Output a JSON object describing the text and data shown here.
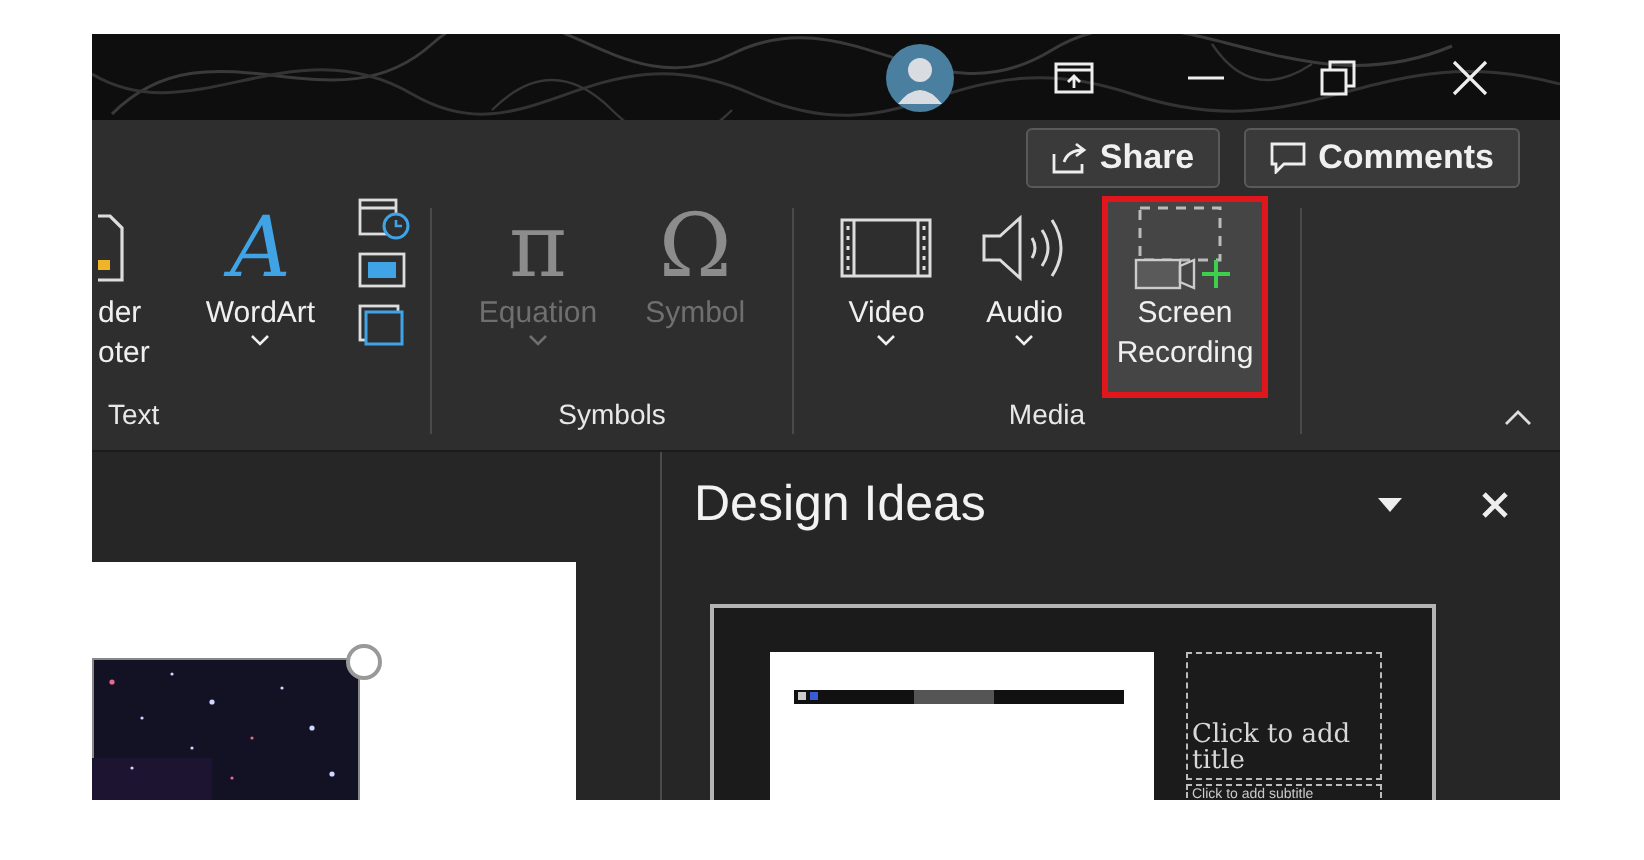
{
  "ribbon": {
    "actions": [
      {
        "kind": "share",
        "label": "Share"
      },
      {
        "kind": "comments",
        "label": "Comments"
      }
    ],
    "groups": [
      {
        "label": "Text",
        "items": [
          {
            "kind": "header-footer",
            "lines": [
              "der",
              "oter"
            ]
          },
          {
            "kind": "wordart",
            "glyph": "A",
            "lines": [
              "WordArt"
            ],
            "dropdown": true
          },
          {
            "kind": "small-stack"
          }
        ]
      },
      {
        "label": "Symbols",
        "items": [
          {
            "kind": "equation",
            "glyph": "π",
            "lines": [
              "Equation"
            ],
            "dropdown": true,
            "disabled": true
          },
          {
            "kind": "symbol",
            "glyph": "Ω",
            "lines": [
              "Symbol"
            ],
            "disabled": true
          }
        ]
      },
      {
        "label": "Media",
        "items": [
          {
            "kind": "video",
            "lines": [
              "Video"
            ],
            "dropdown": true
          },
          {
            "kind": "audio",
            "lines": [
              "Audio"
            ],
            "dropdown": true
          },
          {
            "kind": "screen-recording",
            "lines": [
              "Screen",
              "Recording"
            ],
            "highlighted": true
          }
        ]
      }
    ]
  },
  "design_pane": {
    "title": "Design Ideas",
    "thumbnails": [
      {
        "title_placeholder": "Click to add title",
        "subtitle_placeholder": "Click to add subtitle"
      }
    ]
  }
}
